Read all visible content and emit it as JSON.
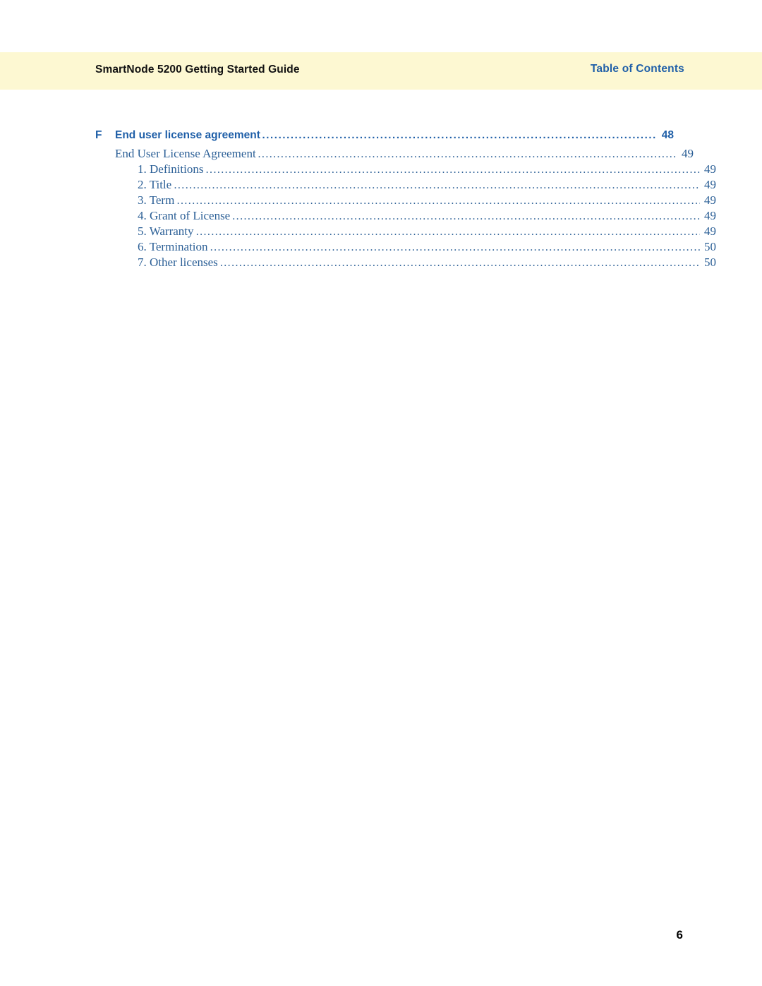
{
  "header": {
    "doc_title": "SmartNode 5200 Getting Started Guide",
    "section_label": "Table of Contents",
    "band_color": "#fdf8d2",
    "accent_color": "#1f5fa8"
  },
  "toc": {
    "entries": [
      {
        "level": 0,
        "letter": "F",
        "title": "End user license agreement",
        "page": "48"
      },
      {
        "level": 1,
        "letter": "",
        "title": "End User License Agreement",
        "page": "49"
      },
      {
        "level": 2,
        "letter": "",
        "title": "1. Definitions",
        "page": "49"
      },
      {
        "level": 2,
        "letter": "",
        "title": "2. Title",
        "page": "49"
      },
      {
        "level": 2,
        "letter": "",
        "title": "3. Term",
        "page": "49"
      },
      {
        "level": 2,
        "letter": "",
        "title": "4. Grant of License",
        "page": "49"
      },
      {
        "level": 2,
        "letter": "",
        "title": "5. Warranty",
        "page": "49"
      },
      {
        "level": 2,
        "letter": "",
        "title": "6. Termination",
        "page": "50"
      },
      {
        "level": 2,
        "letter": "",
        "title": "7. Other licenses",
        "page": "50"
      }
    ]
  },
  "footer": {
    "page_number": "6"
  }
}
